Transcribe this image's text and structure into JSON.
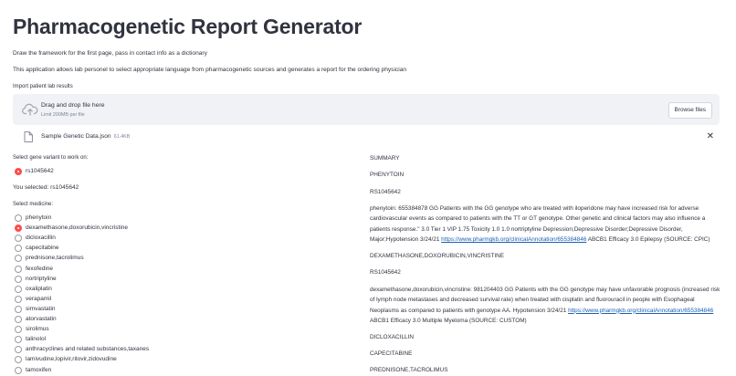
{
  "page_title": "Pharmacogenetic Report Generator",
  "intro_1": "Draw the framework for the first page, pass in contact info as a dictionary",
  "intro_2": "This application allows lab personel to select appropriate language from pharmacogenetic sources and generates a report for the ordering physician",
  "uploader": {
    "label": "Import patient lab results",
    "drop_text": "Drag and drop file here",
    "limit_text": "Limit 200MB per file",
    "browse_label": "Browse files",
    "icon": "upload-cloud-icon"
  },
  "uploaded_file": {
    "name": "Sample Genetic Data.json",
    "size": "61.4KB",
    "icon": "file-icon",
    "close": "✕"
  },
  "gene_select": {
    "label": "Select gene variant to work on:",
    "options": [
      "rs1045642"
    ],
    "selected": "rs1045642"
  },
  "you_selected": "You selected: rs1045642",
  "medicine_select": {
    "label": "Select medicine:",
    "options": [
      "phenytoin",
      "dexamethasone,doxorubicin,vincristine",
      "dicloxacillin",
      "capecitabine",
      "prednisone,tacrolimus",
      "fexofedine",
      "nortriptyline",
      "oxaliplatin",
      "verapamil",
      "simvastatin",
      "atorvastatin",
      "sirolimus",
      "talinolol",
      "anthracyclines and related substances,taxanes",
      "lamivudine,lopivir,ritovir,zidovudine",
      "tamoxifen"
    ],
    "selected_index": 1
  },
  "summary": {
    "heading": "SUMMARY",
    "sections": [
      {
        "drug": "PHENYTOIN",
        "variant": "RS1045642",
        "text": "phenytoin: 655384878 GG Patients with the GG genotype who are treated with iloperidone may have increased risk for adverse cardiovascular events as compared to patients with the TT or GT genotype. Other genetic and clinical factors may also influence a patients response.\" 3.0 Tier 1 VIP 1.75 Toxicity 1.0 1.0 nortriptyline Depression;Depressive Disorder;Depressive Disorder, Major;Hypotension 3/24/21",
        "link": "https://www.pharmgkb.org/clinicalAnnotation/655384846",
        "tail": " ABCB1 Efficacy 3.0 Epilepsy (SOURCE: CPIC)"
      },
      {
        "drug": "DEXAMETHASONE,DOXORUBICIN,VINCRISTINE",
        "variant": "RS1045642",
        "text": "dexamethasone,doxorubicin,vincristine: 981204403 GG Patients with the GG genotype may have unfavorable prognosis (increased risk of lymph node metastases and decreased survival rate) when treated with cisplatin and fluorouracil in people with Esophageal Neoplasms as compared to patients with genotype AA. Hypotension 3/24/21",
        "link": "https://www.pharmgkb.org/clinicalAnnotation/655384846",
        "tail": " ABCB1 Efficacy 3.0 Multiple Myeloma (SOURCE: CUSTOM)"
      }
    ],
    "more_drugs": [
      "DICLOXACILLIN",
      "CAPECITABINE",
      "PREDNISONE,TACROLIMUS"
    ]
  }
}
